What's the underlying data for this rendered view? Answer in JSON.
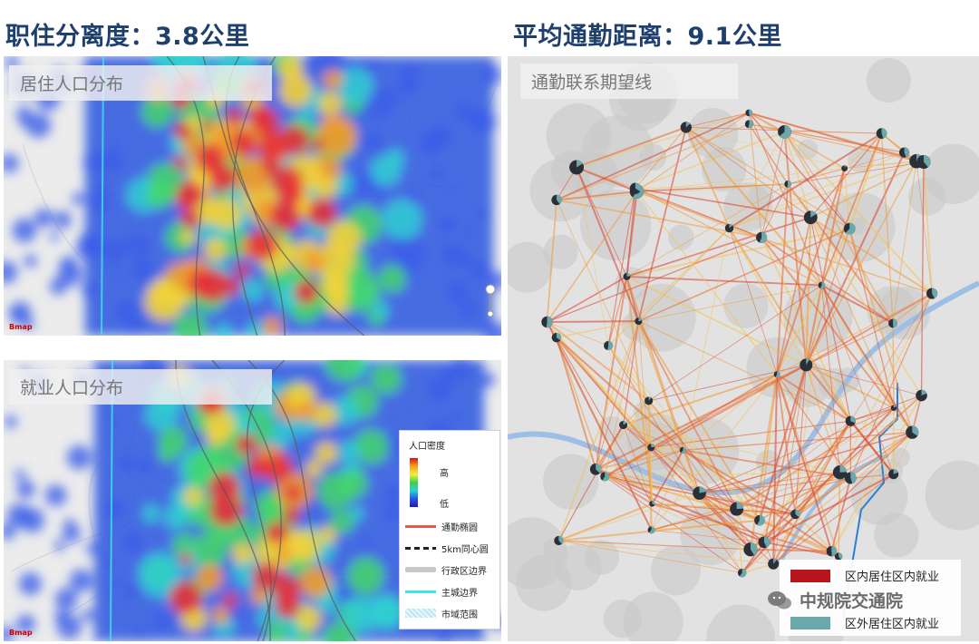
{
  "headlines": {
    "left": "职住分离度：3.8公里",
    "right": "平均通勤距离：9.1公里"
  },
  "panels": {
    "residence_label": "居住人口分布",
    "employment_label": "就业人口分布",
    "desire_label": "通勤联系期望线"
  },
  "density_legend": {
    "title": "人口密度",
    "high": "高",
    "low": "低",
    "items": [
      {
        "label": "通勤椭圆",
        "color": "#e45a4a",
        "style": "solid"
      },
      {
        "label": "5km同心圆",
        "color": "#222222",
        "style": "dashed"
      },
      {
        "label": "行政区边界",
        "color": "#c8c8c8",
        "style": "thick"
      },
      {
        "label": "主城边界",
        "color": "#39e6ee",
        "style": "solid"
      },
      {
        "label": "市域范围",
        "color": "#bfe6f5",
        "style": "hatch"
      }
    ]
  },
  "commute_legend": {
    "items": [
      {
        "label": "区内居住区内就业",
        "color": "#b8141c"
      },
      {
        "label": "区外居住区内就业",
        "color": "#6aa8ac"
      }
    ]
  },
  "watermark": "中规院交通院",
  "colors": {
    "headline": "#1f3f6d",
    "heat_high": "#d8141a",
    "heat_low": "#2218b8",
    "desire_line": "#e8632a",
    "river": "#3b8fd6",
    "boundary": "#2a7fd4"
  },
  "map_badges": {
    "residence": "Bmap",
    "employment": "Bmap"
  }
}
